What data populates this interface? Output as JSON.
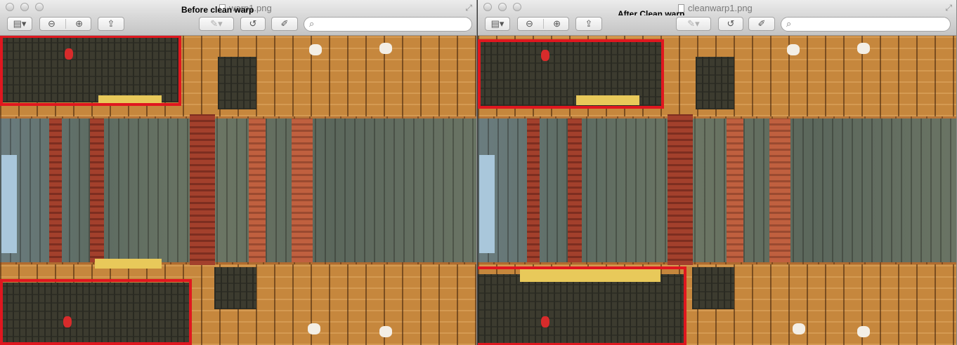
{
  "windows": [
    {
      "id": "left",
      "overlay_label": "Before clean warp",
      "filename": "warp1.png"
    },
    {
      "id": "right",
      "overlay_label": "After Clean warp",
      "filename": "cleanwarp1.png"
    }
  ],
  "toolbar": {
    "sidebar_icon": "sidebar-icon",
    "zoom_out_icon": "zoom-out-icon",
    "zoom_in_icon": "zoom-in-icon",
    "share_icon": "share-icon",
    "annotate_icon": "pen-icon",
    "rotate_icon": "rotate-icon",
    "edit_icon": "markup-icon",
    "search_icon": "search-icon",
    "search_value": ""
  },
  "colors": {
    "highlight": "#e0171f",
    "window_chrome": "#d6d6d6"
  }
}
